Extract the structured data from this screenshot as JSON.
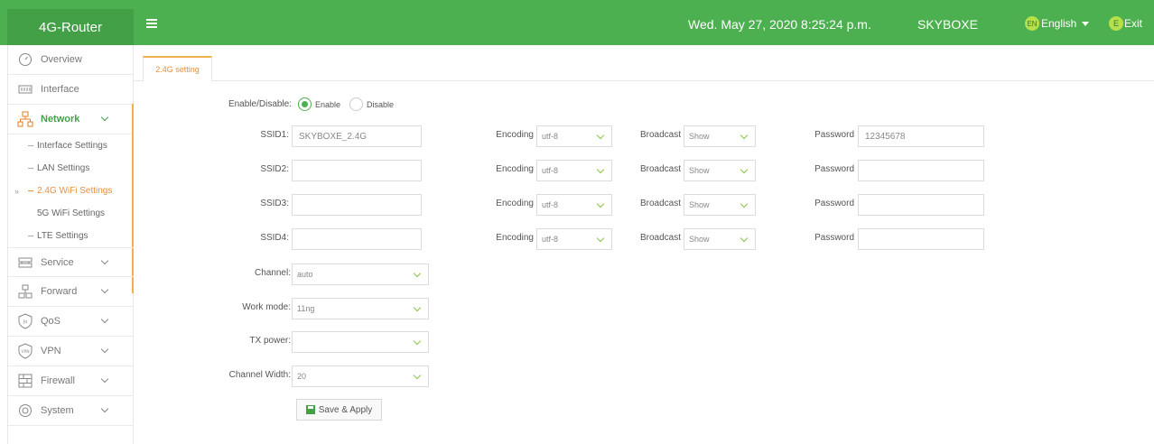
{
  "header": {
    "logo": "4G-Router",
    "datetime": "Wed. May 27, 2020 8:25:24 p.m.",
    "device_name": "SKYBOXE",
    "lang_badge": "EN",
    "language": "English",
    "exit_badge": "E",
    "exit_label": "Exit",
    "colors": {
      "bar": "#4caf50",
      "accent": "#f0b050"
    }
  },
  "sidebar": {
    "overview": "Overview",
    "interface": "Interface",
    "network": "Network",
    "network_sub": {
      "interface_settings": "Interface Settings",
      "lan_settings": "LAN Settings",
      "wifi24_settings": "2.4G WiFi Settings",
      "wifi5_settings": "5G WiFi Settings",
      "lte_settings": "LTE Settings"
    },
    "service": "Service",
    "forward": "Forward",
    "qos": "QoS",
    "vpn": "VPN",
    "firewall": "Firewall",
    "system": "System"
  },
  "tab": {
    "label": "2.4G setting"
  },
  "form": {
    "enable_label": "Enable/Disable:",
    "enable_option": "Enable",
    "disable_option": "Disable",
    "selected": "Enable",
    "ssids": [
      {
        "label": "SSID1:",
        "value": "SKYBOXE_2.4G",
        "encoding_label": "Encoding",
        "encoding": "utf-8",
        "broadcast_label": "Broadcast",
        "broadcast": "Show",
        "password_label": "Password",
        "password": "12345678"
      },
      {
        "label": "SSID2:",
        "value": "",
        "encoding_label": "Encoding",
        "encoding": "utf-8",
        "broadcast_label": "Broadcast",
        "broadcast": "Show",
        "password_label": "Password",
        "password": ""
      },
      {
        "label": "SSID3:",
        "value": "",
        "encoding_label": "Encoding",
        "encoding": "utf-8",
        "broadcast_label": "Broadcast",
        "broadcast": "Show",
        "password_label": "Password",
        "password": ""
      },
      {
        "label": "SSID4:",
        "value": "",
        "encoding_label": "Encoding",
        "encoding": "utf-8",
        "broadcast_label": "Broadcast",
        "broadcast": "Show",
        "password_label": "Password",
        "password": ""
      }
    ],
    "channel_label": "Channel:",
    "channel": "auto",
    "work_mode_label": "Work mode:",
    "work_mode": "11ng",
    "tx_power_label": "TX power:",
    "tx_power": "",
    "channel_width_label": "Channel Width:",
    "channel_width": "20",
    "save_label": "Save & Apply"
  }
}
